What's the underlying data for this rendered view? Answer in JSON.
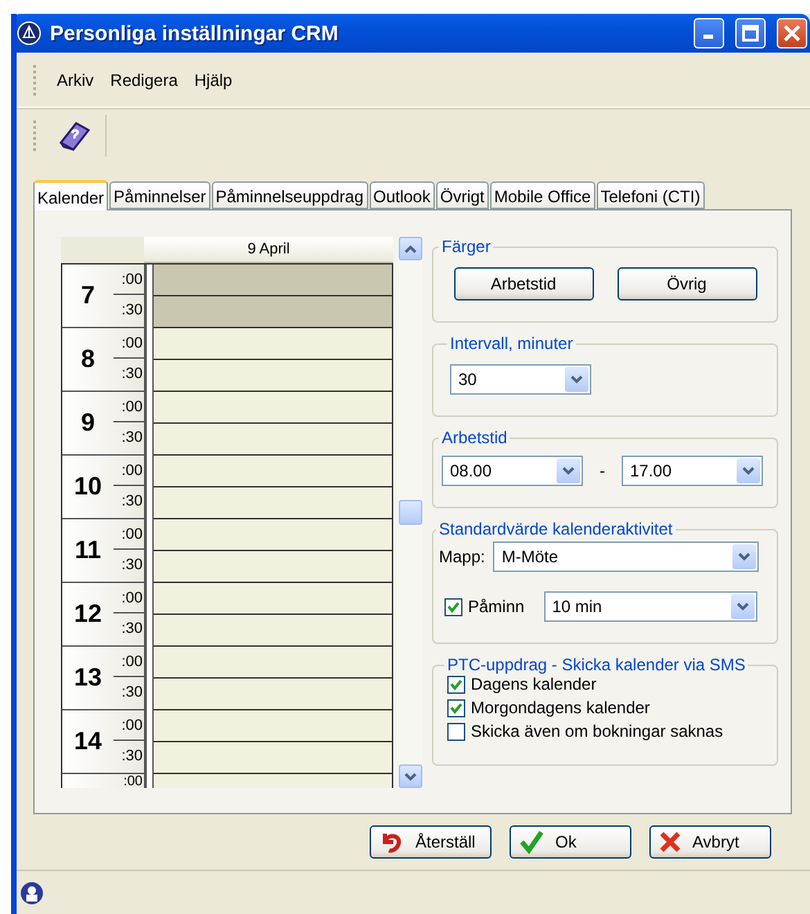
{
  "window": {
    "title": "Personliga inställningar CRM"
  },
  "menu": [
    {
      "label": "Arkiv"
    },
    {
      "label": "Redigera"
    },
    {
      "label": "Hjälp"
    }
  ],
  "tabs": [
    {
      "label": "Kalender",
      "selected": true
    },
    {
      "label": "Påminnelser",
      "selected": false
    },
    {
      "label": "Påminnelseuppdrag",
      "selected": false
    },
    {
      "label": "Outlook",
      "selected": false
    },
    {
      "label": "Övrigt",
      "selected": false
    },
    {
      "label": "Mobile Office",
      "selected": false
    },
    {
      "label": "Telefoni (CTI)",
      "selected": false
    }
  ],
  "calendar": {
    "date": "9 April",
    "hours": [
      {
        "hour": "7",
        "slots": [
          {
            "label": ":00",
            "working": false
          },
          {
            "label": ":30",
            "working": false
          }
        ]
      },
      {
        "hour": "8",
        "slots": [
          {
            "label": ":00",
            "working": true
          },
          {
            "label": ":30",
            "working": true
          }
        ]
      },
      {
        "hour": "9",
        "slots": [
          {
            "label": ":00",
            "working": true
          },
          {
            "label": ":30",
            "working": true
          }
        ]
      },
      {
        "hour": "10",
        "slots": [
          {
            "label": ":00",
            "working": true
          },
          {
            "label": ":30",
            "working": true
          }
        ]
      },
      {
        "hour": "11",
        "slots": [
          {
            "label": ":00",
            "working": true
          },
          {
            "label": ":30",
            "working": true
          }
        ]
      },
      {
        "hour": "12",
        "slots": [
          {
            "label": ":00",
            "working": true
          },
          {
            "label": ":30",
            "working": true
          }
        ]
      },
      {
        "hour": "13",
        "slots": [
          {
            "label": ":00",
            "working": true
          },
          {
            "label": ":30",
            "working": true
          }
        ]
      },
      {
        "hour": "14",
        "slots": [
          {
            "label": ":00",
            "working": true
          },
          {
            "label": ":30",
            "working": true
          }
        ]
      }
    ],
    "cut_off_slot": ":00"
  },
  "colors": {
    "title": "Färger",
    "buttons": [
      {
        "label": "Arbetstid"
      },
      {
        "label": "Övrig"
      }
    ]
  },
  "interval": {
    "title": "Intervall, minuter",
    "value": "30"
  },
  "work_time": {
    "title": "Arbetstid",
    "from": "08.00",
    "separator": "-",
    "to": "17.00"
  },
  "default_activity": {
    "title": "Standardvärde kalenderaktivitet",
    "folder_label": "Mapp:",
    "folder": "M-Möte",
    "reminder": {
      "label": "Påminn",
      "checked": true,
      "value": "10 min"
    }
  },
  "sms": {
    "title": "PTC-uppdrag - Skicka kalender via SMS",
    "options": [
      {
        "label": "Dagens kalender",
        "checked": true
      },
      {
        "label": "Morgondagens kalender",
        "checked": true
      },
      {
        "label": "Skicka även om bokningar saknas",
        "checked": false
      }
    ]
  },
  "buttons": [
    {
      "label": "Återställ",
      "kind": "reset"
    },
    {
      "label": "Ok",
      "kind": "ok"
    },
    {
      "label": "Avbryt",
      "kind": "cancel"
    }
  ]
}
